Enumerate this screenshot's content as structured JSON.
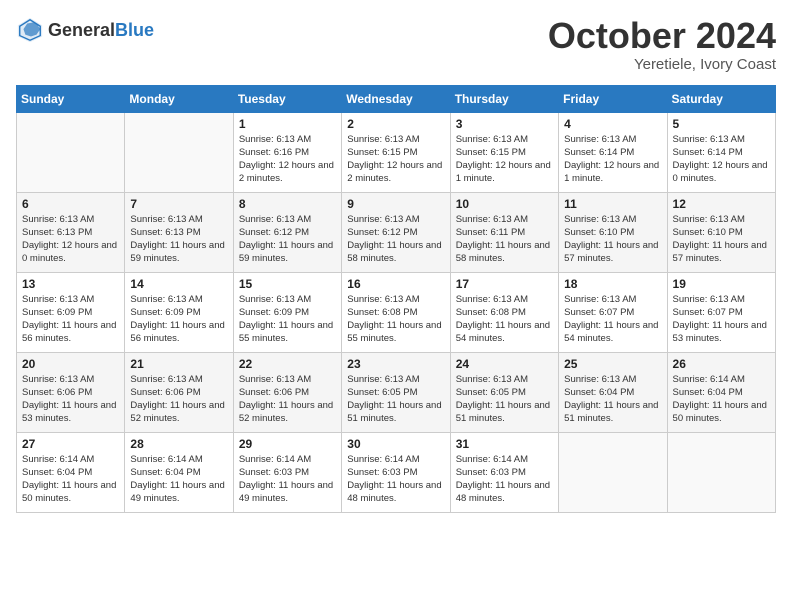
{
  "header": {
    "logo": {
      "text_general": "General",
      "text_blue": "Blue"
    },
    "month": "October 2024",
    "location": "Yeretiele, Ivory Coast"
  },
  "weekdays": [
    "Sunday",
    "Monday",
    "Tuesday",
    "Wednesday",
    "Thursday",
    "Friday",
    "Saturday"
  ],
  "weeks": [
    [
      {
        "day": "",
        "empty": true
      },
      {
        "day": "",
        "empty": true
      },
      {
        "day": "1",
        "sunrise": "6:13 AM",
        "sunset": "6:16 PM",
        "daylight": "12 hours and 2 minutes."
      },
      {
        "day": "2",
        "sunrise": "6:13 AM",
        "sunset": "6:15 PM",
        "daylight": "12 hours and 2 minutes."
      },
      {
        "day": "3",
        "sunrise": "6:13 AM",
        "sunset": "6:15 PM",
        "daylight": "12 hours and 1 minute."
      },
      {
        "day": "4",
        "sunrise": "6:13 AM",
        "sunset": "6:14 PM",
        "daylight": "12 hours and 1 minute."
      },
      {
        "day": "5",
        "sunrise": "6:13 AM",
        "sunset": "6:14 PM",
        "daylight": "12 hours and 0 minutes."
      }
    ],
    [
      {
        "day": "6",
        "sunrise": "6:13 AM",
        "sunset": "6:13 PM",
        "daylight": "12 hours and 0 minutes."
      },
      {
        "day": "7",
        "sunrise": "6:13 AM",
        "sunset": "6:13 PM",
        "daylight": "11 hours and 59 minutes."
      },
      {
        "day": "8",
        "sunrise": "6:13 AM",
        "sunset": "6:12 PM",
        "daylight": "11 hours and 59 minutes."
      },
      {
        "day": "9",
        "sunrise": "6:13 AM",
        "sunset": "6:12 PM",
        "daylight": "11 hours and 58 minutes."
      },
      {
        "day": "10",
        "sunrise": "6:13 AM",
        "sunset": "6:11 PM",
        "daylight": "11 hours and 58 minutes."
      },
      {
        "day": "11",
        "sunrise": "6:13 AM",
        "sunset": "6:10 PM",
        "daylight": "11 hours and 57 minutes."
      },
      {
        "day": "12",
        "sunrise": "6:13 AM",
        "sunset": "6:10 PM",
        "daylight": "11 hours and 57 minutes."
      }
    ],
    [
      {
        "day": "13",
        "sunrise": "6:13 AM",
        "sunset": "6:09 PM",
        "daylight": "11 hours and 56 minutes."
      },
      {
        "day": "14",
        "sunrise": "6:13 AM",
        "sunset": "6:09 PM",
        "daylight": "11 hours and 56 minutes."
      },
      {
        "day": "15",
        "sunrise": "6:13 AM",
        "sunset": "6:09 PM",
        "daylight": "11 hours and 55 minutes."
      },
      {
        "day": "16",
        "sunrise": "6:13 AM",
        "sunset": "6:08 PM",
        "daylight": "11 hours and 55 minutes."
      },
      {
        "day": "17",
        "sunrise": "6:13 AM",
        "sunset": "6:08 PM",
        "daylight": "11 hours and 54 minutes."
      },
      {
        "day": "18",
        "sunrise": "6:13 AM",
        "sunset": "6:07 PM",
        "daylight": "11 hours and 54 minutes."
      },
      {
        "day": "19",
        "sunrise": "6:13 AM",
        "sunset": "6:07 PM",
        "daylight": "11 hours and 53 minutes."
      }
    ],
    [
      {
        "day": "20",
        "sunrise": "6:13 AM",
        "sunset": "6:06 PM",
        "daylight": "11 hours and 53 minutes."
      },
      {
        "day": "21",
        "sunrise": "6:13 AM",
        "sunset": "6:06 PM",
        "daylight": "11 hours and 52 minutes."
      },
      {
        "day": "22",
        "sunrise": "6:13 AM",
        "sunset": "6:06 PM",
        "daylight": "11 hours and 52 minutes."
      },
      {
        "day": "23",
        "sunrise": "6:13 AM",
        "sunset": "6:05 PM",
        "daylight": "11 hours and 51 minutes."
      },
      {
        "day": "24",
        "sunrise": "6:13 AM",
        "sunset": "6:05 PM",
        "daylight": "11 hours and 51 minutes."
      },
      {
        "day": "25",
        "sunrise": "6:13 AM",
        "sunset": "6:04 PM",
        "daylight": "11 hours and 51 minutes."
      },
      {
        "day": "26",
        "sunrise": "6:14 AM",
        "sunset": "6:04 PM",
        "daylight": "11 hours and 50 minutes."
      }
    ],
    [
      {
        "day": "27",
        "sunrise": "6:14 AM",
        "sunset": "6:04 PM",
        "daylight": "11 hours and 50 minutes."
      },
      {
        "day": "28",
        "sunrise": "6:14 AM",
        "sunset": "6:04 PM",
        "daylight": "11 hours and 49 minutes."
      },
      {
        "day": "29",
        "sunrise": "6:14 AM",
        "sunset": "6:03 PM",
        "daylight": "11 hours and 49 minutes."
      },
      {
        "day": "30",
        "sunrise": "6:14 AM",
        "sunset": "6:03 PM",
        "daylight": "11 hours and 48 minutes."
      },
      {
        "day": "31",
        "sunrise": "6:14 AM",
        "sunset": "6:03 PM",
        "daylight": "11 hours and 48 minutes."
      },
      {
        "day": "",
        "empty": true
      },
      {
        "day": "",
        "empty": true
      }
    ]
  ],
  "daylight_label": "Daylight hours",
  "sunrise_label": "Sunrise:",
  "sunset_label": "Sunset:"
}
